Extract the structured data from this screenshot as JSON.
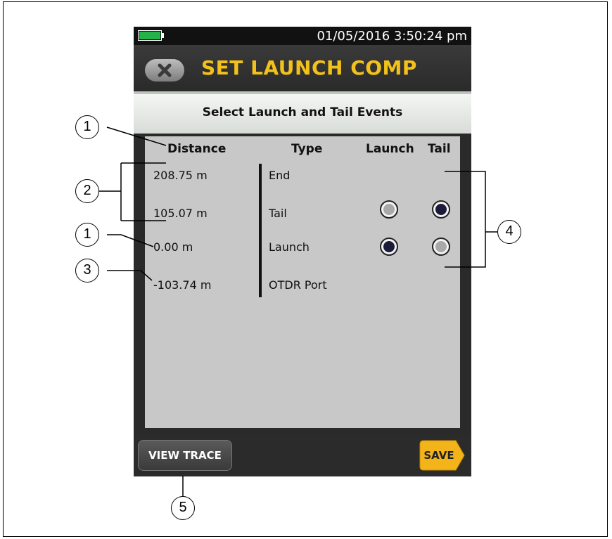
{
  "status_bar": {
    "datetime": "01/05/2016 3:50:24 pm"
  },
  "title_bar": {
    "title": "SET LAUNCH COMP"
  },
  "subheader": {
    "text": "Select Launch and Tail Events"
  },
  "table": {
    "columns": {
      "distance": "Distance",
      "type": "Type",
      "launch": "Launch",
      "tail": "Tail"
    },
    "rows": [
      {
        "distance": "208.75 m",
        "type": "End",
        "launch": null,
        "tail": null
      },
      {
        "distance": "105.07 m",
        "type": "Tail",
        "launch": "unselected",
        "tail": "selected"
      },
      {
        "distance": "0.00 m",
        "type": "Launch",
        "launch": "selected",
        "tail": "unselected"
      },
      {
        "distance": "-103.74 m",
        "type": "OTDR Port",
        "launch": null,
        "tail": null
      }
    ]
  },
  "bottom_bar": {
    "view_trace_label": "VIEW TRACE",
    "save_label": "SAVE"
  },
  "callouts": [
    "1",
    "2",
    "1",
    "3",
    "4",
    "5"
  ],
  "colors": {
    "title": "#f2c21b",
    "battery": "#24b34a",
    "save_button": "#f3b41a",
    "selected_radio": "#1c1c3a"
  }
}
